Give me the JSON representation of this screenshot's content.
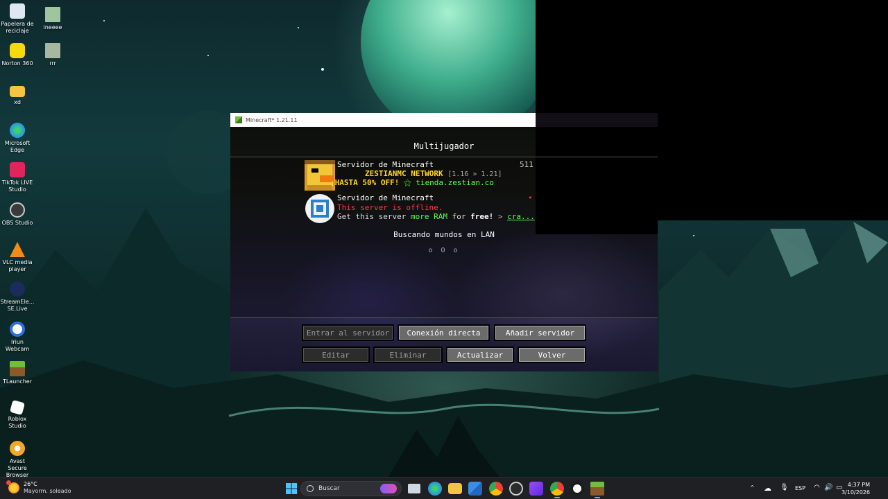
{
  "desktop": {
    "icons": [
      {
        "name": "recycle-bin-icon",
        "label1": "Papelera de",
        "label2": "reciclaje",
        "color": "#dfe8f0"
      },
      {
        "name": "ineeee-file-icon",
        "label1": "ineeee",
        "label2": "",
        "color": "#9fc4a0"
      },
      {
        "name": "norton-360-icon",
        "label1": "Norton 360",
        "label2": "",
        "color": "#f5d90c"
      },
      {
        "name": "rrr-file-icon",
        "label1": "rrr",
        "label2": "",
        "color": "#a8b8a0"
      },
      {
        "name": "xd-folder-icon",
        "label1": "xd",
        "label2": "",
        "color": "#f4c542"
      },
      {
        "name": "microsoft-edge-icon",
        "label1": "Microsoft",
        "label2": "Edge",
        "color": "#2c9bd8"
      },
      {
        "name": "tiktok-live-studio-icon",
        "label1": "TikTok LIVE",
        "label2": "Studio",
        "color": "#e0245e"
      },
      {
        "name": "obs-studio-icon",
        "label1": "OBS Studio",
        "label2": "",
        "color": "#3a3a3a"
      },
      {
        "name": "vlc-media-player-icon",
        "label1": "VLC media",
        "label2": "player",
        "color": "#f08c1a"
      },
      {
        "name": "streamelements-icon",
        "label1": "StreamEle...",
        "label2": "SE.Live",
        "color": "#1a2b5c"
      },
      {
        "name": "iriun-webcam-icon",
        "label1": "Iriun",
        "label2": "Webcam",
        "color": "#2f6fe0"
      },
      {
        "name": "tlauncher-icon",
        "label1": "TLauncher",
        "label2": "",
        "color": "#5ba436"
      },
      {
        "name": "roblox-studio-icon",
        "label1": "Roblox",
        "label2": "Studio",
        "color": "#ffffff"
      },
      {
        "name": "avast-secure-browser-icon",
        "label1": "Avast Secure",
        "label2": "Browser",
        "color": "#f5a623"
      }
    ]
  },
  "window": {
    "title": "Minecraft* 1.21.11"
  },
  "minecraft": {
    "heading": "Multijugador",
    "servers": [
      {
        "name": "Servidor de Minecraft",
        "count": "511",
        "motd1_a": "ZESTIANMC NETWORK",
        "motd1_b": "[1.16 » 1.21]",
        "motd2_a": "¡HASTA 50% OFF!",
        "motd2_b": "⚝ tienda.zestian.co",
        "color_a": "#ffd42a",
        "color_b": "#55ff55"
      },
      {
        "name": "Servidor de Minecraft",
        "line1": "This server is offline.",
        "line2_a": "Get this server",
        "line2_b": "more RAM",
        "line2_c": "for",
        "line2_d": "free!",
        "line2_e": ">",
        "line2_f": "cra...",
        "color_red": "#ff3b3b",
        "color_green": "#55ff55"
      }
    ],
    "lan_text": "Buscando mundos en LAN",
    "lan_dots": "o O o",
    "buttons": {
      "join": "Entrar al servidor",
      "direct": "Conexión directa",
      "add": "Añadir servidor",
      "edit": "Editar",
      "delete": "Eliminar",
      "refresh": "Actualizar",
      "back": "Volver"
    }
  },
  "taskbar": {
    "temp": "26°C",
    "condition": "Mayorm. soleado",
    "search_placeholder": "Buscar",
    "language": "ESP",
    "time": "4:37 PM",
    "date": "3/10/2026"
  }
}
